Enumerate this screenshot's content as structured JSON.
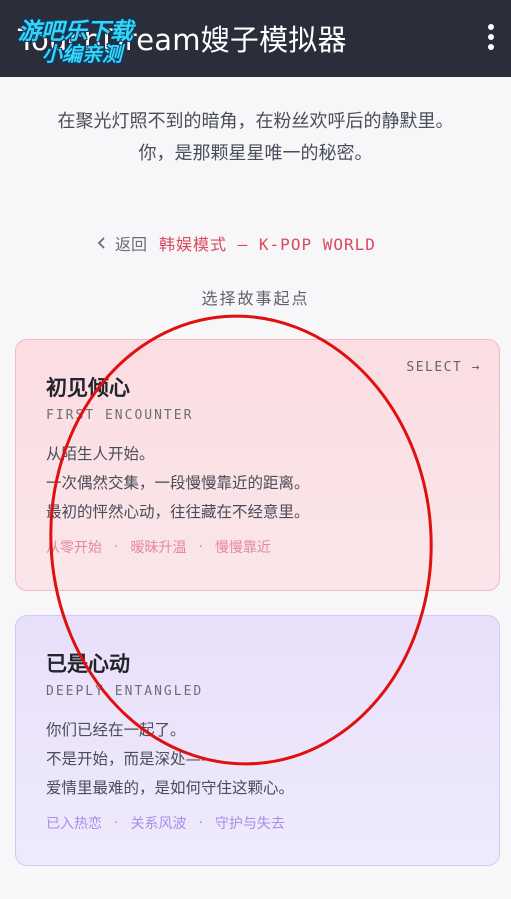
{
  "app": {
    "title": "TouchDream嫂子模拟器",
    "watermark_line1": "游吧乐下载",
    "watermark_line2": "小编亲测"
  },
  "intro": {
    "line1": "在聚光灯照不到的暗角，在粉丝欢呼后的静默里。",
    "line2": "你，是那颗星星唯一的秘密。"
  },
  "nav": {
    "back_label": "返回",
    "mode_label": "韩娱模式 — K-POP WORLD"
  },
  "section_heading": "选择故事起点",
  "cards": [
    {
      "select_label": "SELECT →",
      "title": "初见倾心",
      "subtitle": "FIRST ENCOUNTER",
      "body": [
        "从陌生人开始。",
        "一次偶然交集，一段慢慢靠近的距离。",
        "最初的怦然心动，往往藏在不经意里。"
      ],
      "tags": [
        "从零开始",
        "暧昧升温",
        "慢慢靠近"
      ]
    },
    {
      "title": "已是心动",
      "subtitle": "DEEPLY ENTANGLED",
      "body": [
        "你们已经在一起了。",
        "不是开始，而是深处——",
        "爱情里最难的，是如何守住这颗心。"
      ],
      "tags": [
        "已入热恋",
        "关系风波",
        "守护与失去"
      ]
    }
  ],
  "tag_separator": "·",
  "colors": {
    "topbar": "#2a2d3a",
    "accent_red": "#d94a5f",
    "card_pink": "#fbdde2",
    "card_purple": "#e8e0fa",
    "annotation_circle": "#e01010"
  },
  "icons": {
    "more": "more-vertical-icon",
    "back": "chevron-left-icon"
  }
}
